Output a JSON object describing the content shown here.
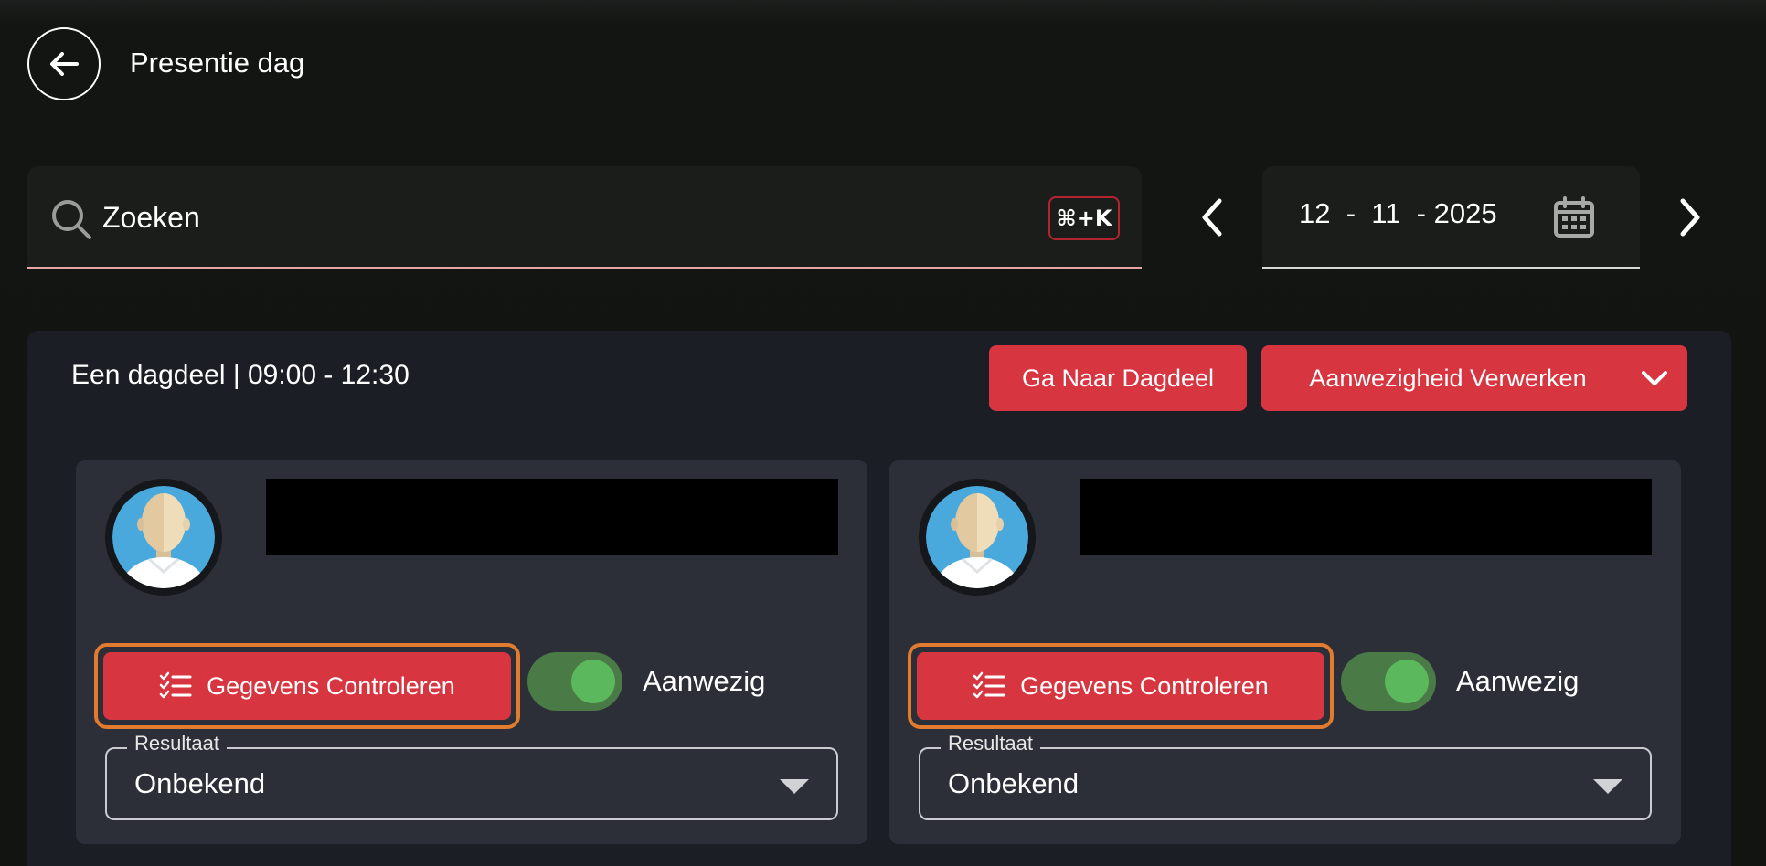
{
  "header": {
    "title": "Presentie dag",
    "back_icon": "arrow-left-icon"
  },
  "search": {
    "placeholder": "Zoeken",
    "value": "",
    "shortcut": "⌘+K"
  },
  "date_nav": {
    "date_display": "12  -  11  - 2025",
    "prev_icon": "chevron-left-icon",
    "next_icon": "chevron-right-icon",
    "calendar_icon": "calendar-icon"
  },
  "panel": {
    "title": "Een dagdeel | 09:00 - 12:30",
    "goto_label": "Ga Naar Dagdeel",
    "process_label": "Aanwezigheid Verwerken",
    "expand_icon": "chevron-down-icon"
  },
  "cards": [
    {
      "check_label": "Gegevens Controleren",
      "toggle_on": true,
      "toggle_label": "Aanwezig",
      "result_legend": "Resultaat",
      "result_value": "Onbekend"
    },
    {
      "check_label": "Gegevens Controleren",
      "toggle_on": true,
      "toggle_label": "Aanwezig",
      "result_legend": "Resultaat",
      "result_value": "Onbekend"
    }
  ],
  "colors": {
    "accent_red": "#d7353f",
    "focus_orange": "#e07b2f",
    "toggle_track": "#4a7a45",
    "toggle_knob": "#5cb85c",
    "panel_bg": "#1b1e25",
    "card_bg": "#2c2f37"
  }
}
